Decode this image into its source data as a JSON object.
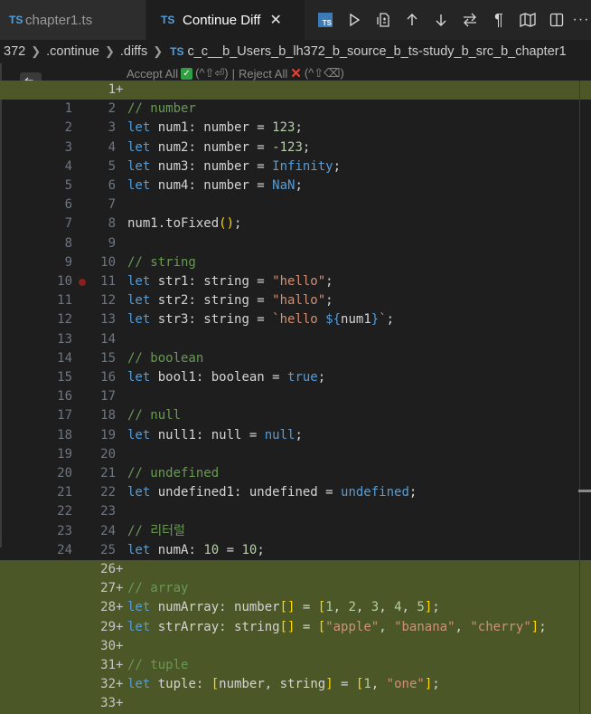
{
  "tabs": [
    {
      "icon": "TS",
      "label": "chapter1.ts",
      "active": false
    },
    {
      "icon": "TS",
      "label": "Continue Diff",
      "active": true,
      "close": "✕"
    }
  ],
  "toolbar_icons": [
    "ts-preview-icon",
    "run-icon",
    "open-changes-icon",
    "arrow-up-icon",
    "arrow-down-icon",
    "swap-icon",
    "pilcrow-icon",
    "map-icon",
    "split-editor-icon",
    "more-icon"
  ],
  "breadcrumb": {
    "items": [
      "372",
      ".continue",
      ".diffs"
    ],
    "file_icon": "TS",
    "file": "c_c__b_Users_b_lh372_b_source_b_ts-study_b_src_b_chapter1"
  },
  "diffbar": {
    "accept_label": "Accept All",
    "accept_shortcut": "(^⇧⏎)",
    "divider": "|",
    "reject_label": "Reject All",
    "reject_shortcut": "(^⇧⌫)"
  },
  "lines": [
    {
      "old": "",
      "new": "1",
      "plus": "+",
      "kind": "added",
      "tokens": []
    },
    {
      "old": "1",
      "new": "2",
      "plus": "",
      "kind": "ctx",
      "tokens": [
        [
          "cm",
          "// number"
        ]
      ]
    },
    {
      "old": "2",
      "new": "3",
      "plus": "",
      "kind": "ctx",
      "tokens": [
        [
          "kw",
          "let"
        ],
        [
          "ty",
          " num1: number = "
        ],
        [
          "nm",
          "123"
        ],
        [
          "ty",
          ";"
        ]
      ]
    },
    {
      "old": "3",
      "new": "4",
      "plus": "",
      "kind": "ctx",
      "tokens": [
        [
          "kw",
          "let"
        ],
        [
          "ty",
          " num2: number = "
        ],
        [
          "nm",
          "-123"
        ],
        [
          "ty",
          ";"
        ]
      ]
    },
    {
      "old": "4",
      "new": "5",
      "plus": "",
      "kind": "ctx",
      "tokens": [
        [
          "kw",
          "let"
        ],
        [
          "ty",
          " num3: number = "
        ],
        [
          "kw",
          "Infinity"
        ],
        [
          "ty",
          ";"
        ]
      ]
    },
    {
      "old": "5",
      "new": "6",
      "plus": "",
      "kind": "ctx",
      "tokens": [
        [
          "kw",
          "let"
        ],
        [
          "ty",
          " num4: number = "
        ],
        [
          "kw",
          "NaN"
        ],
        [
          "ty",
          ";"
        ]
      ]
    },
    {
      "old": "6",
      "new": "7",
      "plus": "",
      "kind": "ctx",
      "tokens": []
    },
    {
      "old": "7",
      "new": "8",
      "plus": "",
      "kind": "ctx",
      "tokens": [
        [
          "ty",
          "num1.toFixed"
        ],
        [
          "br",
          "()"
        ],
        [
          "ty",
          ";"
        ]
      ]
    },
    {
      "old": "8",
      "new": "9",
      "plus": "",
      "kind": "ctx",
      "tokens": []
    },
    {
      "old": "9",
      "new": "10",
      "plus": "",
      "kind": "ctx",
      "tokens": [
        [
          "cm",
          "// string"
        ]
      ]
    },
    {
      "old": "10",
      "new": "11",
      "plus": "",
      "kind": "ctx",
      "bp": true,
      "tokens": [
        [
          "kw",
          "let"
        ],
        [
          "ty",
          " str1: string = "
        ],
        [
          "st",
          "\"hello\""
        ],
        [
          "ty",
          ";"
        ]
      ]
    },
    {
      "old": "11",
      "new": "12",
      "plus": "",
      "kind": "ctx",
      "tokens": [
        [
          "kw",
          "let"
        ],
        [
          "ty",
          " str2: string = "
        ],
        [
          "st",
          "\"hallo\""
        ],
        [
          "ty",
          ";"
        ]
      ]
    },
    {
      "old": "12",
      "new": "13",
      "plus": "",
      "kind": "ctx",
      "tokens": [
        [
          "kw",
          "let"
        ],
        [
          "ty",
          " str3: string = "
        ],
        [
          "st",
          "`hello "
        ],
        [
          "kw",
          "${"
        ],
        [
          "ty",
          "num1"
        ],
        [
          "kw",
          "}"
        ],
        [
          "st",
          "`"
        ],
        [
          "ty",
          ";"
        ]
      ]
    },
    {
      "old": "13",
      "new": "14",
      "plus": "",
      "kind": "ctx",
      "tokens": []
    },
    {
      "old": "14",
      "new": "15",
      "plus": "",
      "kind": "ctx",
      "tokens": [
        [
          "cm",
          "// boolean"
        ]
      ]
    },
    {
      "old": "15",
      "new": "16",
      "plus": "",
      "kind": "ctx",
      "tokens": [
        [
          "kw",
          "let"
        ],
        [
          "ty",
          " bool1: boolean = "
        ],
        [
          "kw",
          "true"
        ],
        [
          "ty",
          ";"
        ]
      ]
    },
    {
      "old": "16",
      "new": "17",
      "plus": "",
      "kind": "ctx",
      "tokens": []
    },
    {
      "old": "17",
      "new": "18",
      "plus": "",
      "kind": "ctx",
      "tokens": [
        [
          "cm",
          "// null"
        ]
      ]
    },
    {
      "old": "18",
      "new": "19",
      "plus": "",
      "kind": "ctx",
      "tokens": [
        [
          "kw",
          "let"
        ],
        [
          "ty",
          " null1: null = "
        ],
        [
          "kw",
          "null"
        ],
        [
          "ty",
          ";"
        ]
      ]
    },
    {
      "old": "19",
      "new": "20",
      "plus": "",
      "kind": "ctx",
      "tokens": []
    },
    {
      "old": "20",
      "new": "21",
      "plus": "",
      "kind": "ctx",
      "tokens": [
        [
          "cm",
          "// undefined"
        ]
      ]
    },
    {
      "old": "21",
      "new": "22",
      "plus": "",
      "kind": "ctx",
      "tokens": [
        [
          "kw",
          "let"
        ],
        [
          "ty",
          " undefined1: undefined = "
        ],
        [
          "kw",
          "undefined"
        ],
        [
          "ty",
          ";"
        ]
      ]
    },
    {
      "old": "22",
      "new": "23",
      "plus": "",
      "kind": "ctx",
      "tokens": []
    },
    {
      "old": "23",
      "new": "24",
      "plus": "",
      "kind": "ctx",
      "tokens": [
        [
          "cm",
          "// 리터럴"
        ]
      ]
    },
    {
      "old": "24",
      "new": "25",
      "plus": "",
      "kind": "ctx",
      "tokens": [
        [
          "kw",
          "let"
        ],
        [
          "ty",
          " numA: "
        ],
        [
          "nm",
          "10"
        ],
        [
          "ty",
          " = "
        ],
        [
          "nm",
          "10"
        ],
        [
          "ty",
          ";"
        ]
      ]
    },
    {
      "old": "",
      "new": "26",
      "plus": "+",
      "kind": "added",
      "tokens": []
    },
    {
      "old": "",
      "new": "27",
      "plus": "+",
      "kind": "added",
      "tokens": [
        [
          "cm",
          "// array"
        ]
      ]
    },
    {
      "old": "",
      "new": "28",
      "plus": "+",
      "kind": "added",
      "tokens": [
        [
          "kw",
          "let"
        ],
        [
          "ty",
          " numArray: number"
        ],
        [
          "br",
          "[]"
        ],
        [
          "ty",
          " = "
        ],
        [
          "br",
          "["
        ],
        [
          "nm",
          "1"
        ],
        [
          "ty",
          ", "
        ],
        [
          "nm",
          "2"
        ],
        [
          "ty",
          ", "
        ],
        [
          "nm",
          "3"
        ],
        [
          "ty",
          ", "
        ],
        [
          "nm",
          "4"
        ],
        [
          "ty",
          ", "
        ],
        [
          "nm",
          "5"
        ],
        [
          "br",
          "]"
        ],
        [
          "ty",
          ";"
        ]
      ]
    },
    {
      "old": "",
      "new": "29",
      "plus": "+",
      "kind": "added",
      "tokens": [
        [
          "kw",
          "let"
        ],
        [
          "ty",
          " strArray: string"
        ],
        [
          "br",
          "[]"
        ],
        [
          "ty",
          " = "
        ],
        [
          "br",
          "["
        ],
        [
          "st",
          "\"apple\""
        ],
        [
          "ty",
          ", "
        ],
        [
          "st",
          "\"banana\""
        ],
        [
          "ty",
          ", "
        ],
        [
          "st",
          "\"cherry\""
        ],
        [
          "br",
          "]"
        ],
        [
          "ty",
          ";"
        ]
      ]
    },
    {
      "old": "",
      "new": "30",
      "plus": "+",
      "kind": "added",
      "tokens": []
    },
    {
      "old": "",
      "new": "31",
      "plus": "+",
      "kind": "added",
      "tokens": [
        [
          "cm",
          "// tuple"
        ]
      ]
    },
    {
      "old": "",
      "new": "32",
      "plus": "+",
      "kind": "added",
      "tokens": [
        [
          "kw",
          "let"
        ],
        [
          "ty",
          " tuple: "
        ],
        [
          "br",
          "["
        ],
        [
          "ty",
          "number, string"
        ],
        [
          "br",
          "]"
        ],
        [
          "ty",
          " = "
        ],
        [
          "br",
          "["
        ],
        [
          "nm",
          "1"
        ],
        [
          "ty",
          ", "
        ],
        [
          "st",
          "\"one\""
        ],
        [
          "br",
          "]"
        ],
        [
          "ty",
          ";"
        ]
      ]
    },
    {
      "old": "",
      "new": "33",
      "plus": "+",
      "kind": "added",
      "tokens": []
    }
  ],
  "colors": {
    "added_bg": "#4b5727",
    "keyword": "#569cd6",
    "comment": "#6a9955",
    "number": "#b5cea8",
    "string": "#ce9178"
  }
}
